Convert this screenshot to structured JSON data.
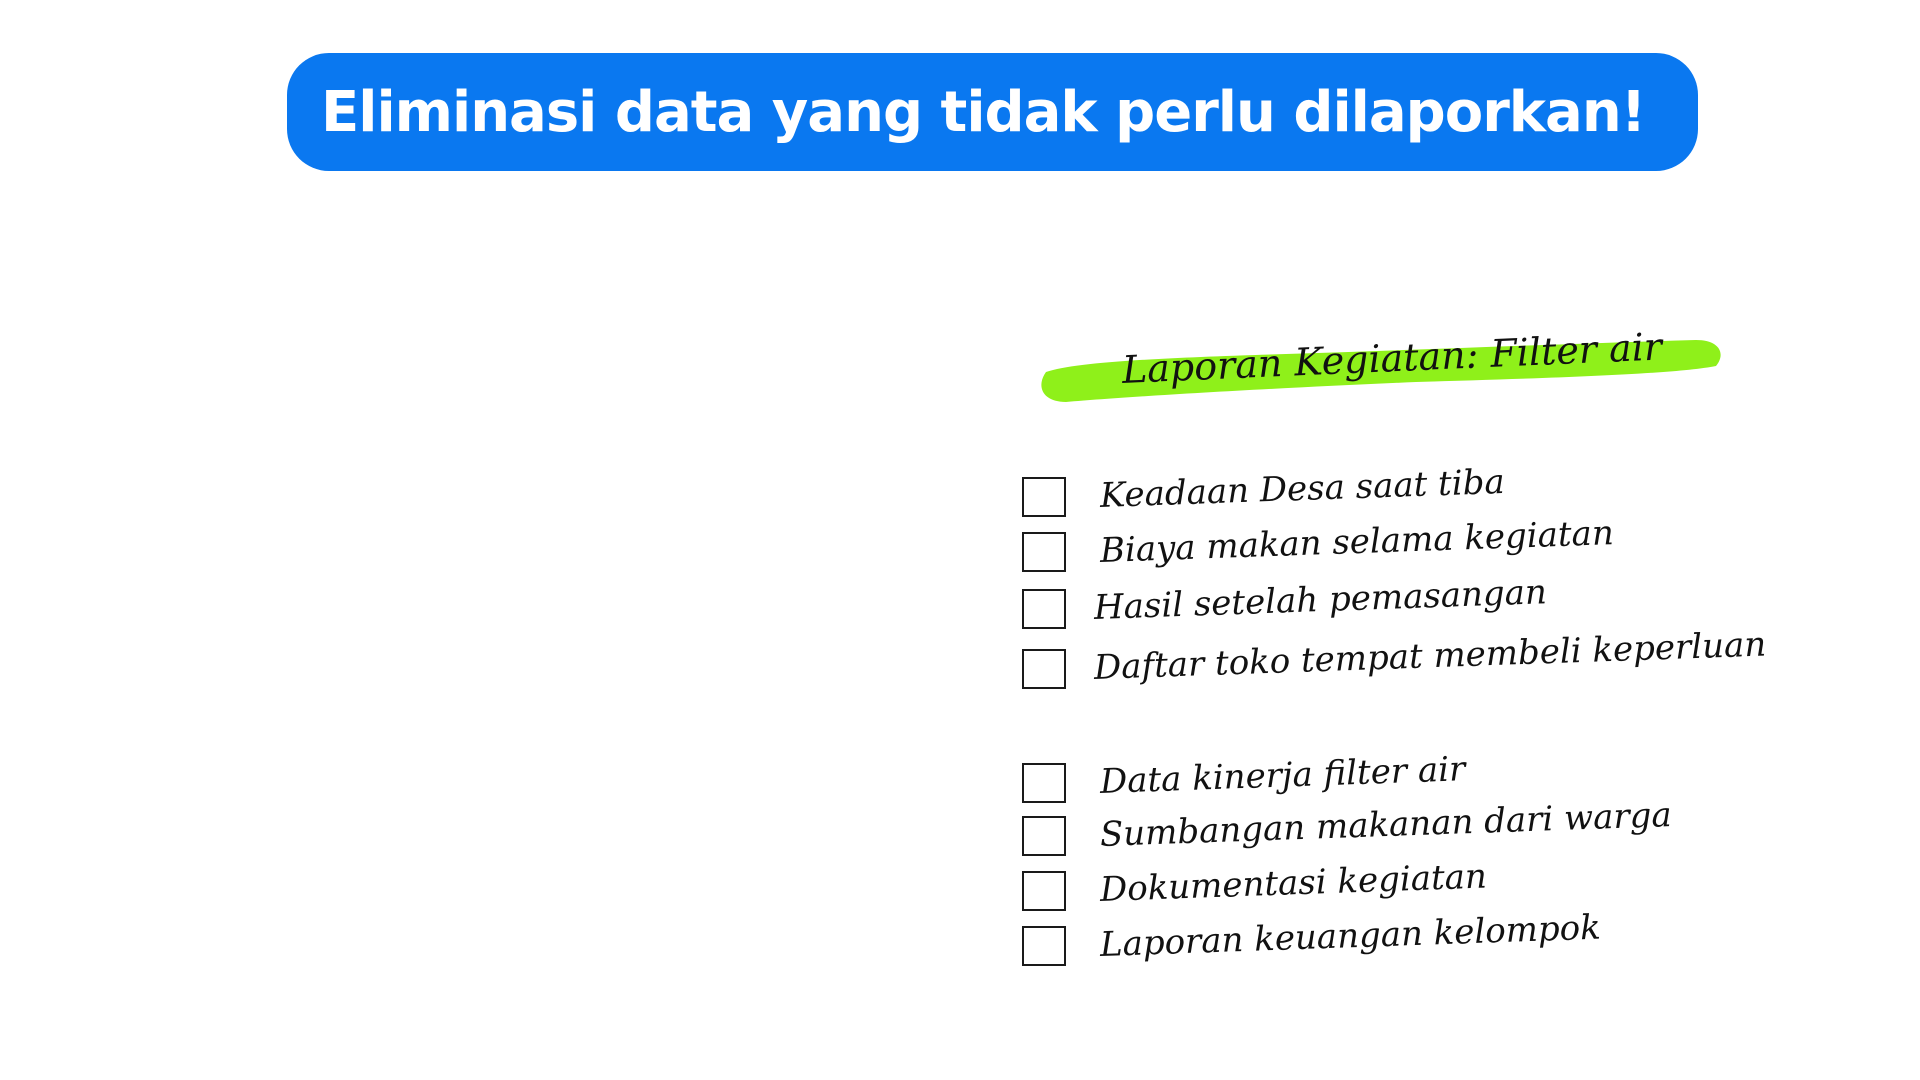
{
  "banner": {
    "title": "Eliminasi data yang tidak perlu dilaporkan!",
    "color": "#0a78f0"
  },
  "report": {
    "heading": "Laporan Kegiatan: Filter air",
    "highlight_color": "#8ff01a",
    "group1": [
      "Keadaan Desa saat tiba",
      "Biaya makan selama kegiatan",
      "Hasil setelah pemasangan",
      "Daftar toko tempat membeli keperluan"
    ],
    "group2": [
      "Data kinerja filter air",
      "Sumbangan makanan dari warga",
      "Dokumentasi kegiatan",
      "Laporan keuangan kelompok"
    ]
  }
}
